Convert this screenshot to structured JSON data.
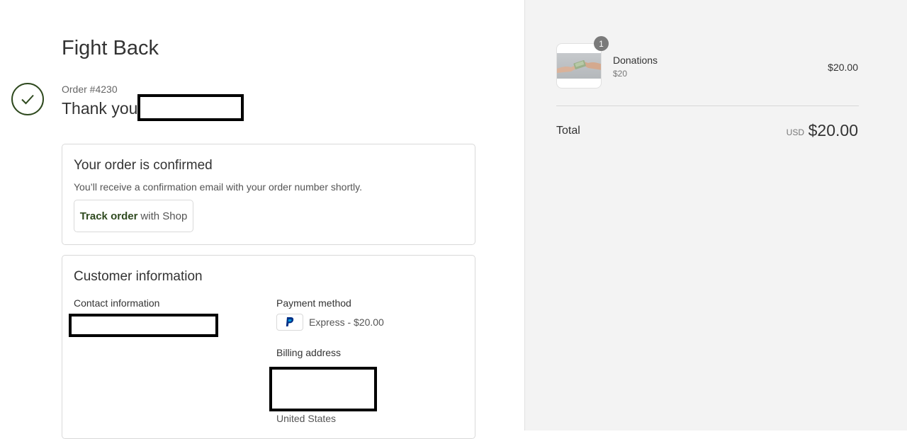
{
  "header": {
    "shop_name": "Fight Back"
  },
  "order": {
    "number_label": "Order #4230",
    "thank_you": "Thank you"
  },
  "confirmation": {
    "title": "Your order is confirmed",
    "text": "You’ll receive a confirmation email with your order number shortly.",
    "track_bold": "Track order",
    "track_rest": "with Shop"
  },
  "customer": {
    "title": "Customer information",
    "contact_label": "Contact information",
    "payment_label": "Payment method",
    "payment_text": "Express - $20.00",
    "payment_icon": "paypal-icon",
    "billing_label": "Billing address",
    "billing_country": "United States"
  },
  "summary": {
    "item": {
      "name": "Donations",
      "variant": "$20",
      "price": "$20.00",
      "quantity": "1"
    },
    "total_label": "Total",
    "currency": "USD",
    "total_amount": "$20.00"
  },
  "colors": {
    "accent": "#2f4a1f",
    "sidebar_bg": "#f3f3f3",
    "border": "#d9d9d9"
  }
}
